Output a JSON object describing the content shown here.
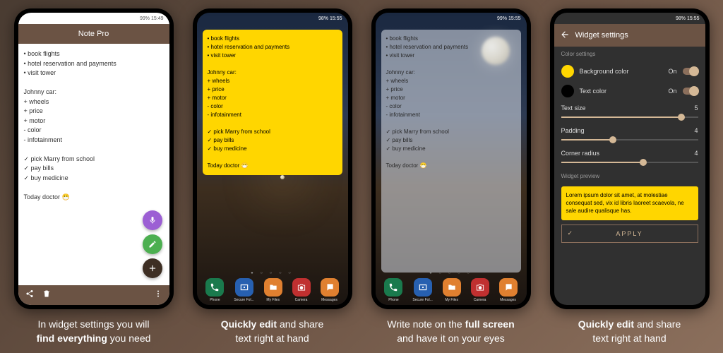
{
  "status": {
    "battery": "99%",
    "t1": "15:49",
    "t2": "15:55",
    "t3": "15:55",
    "t4": "15:55",
    "battery2": "98%"
  },
  "s1": {
    "title": "Note Pro"
  },
  "note": {
    "l1": "• book flights",
    "l2": "• hotel reservation and payments",
    "l3": "• visit tower",
    "l4": "Johnny car:",
    "l5": "+ wheels",
    "l6": "+ price",
    "l7": "+ motor",
    "l8": "- color",
    "l9": "- infotainment",
    "l10": "✓ pick Marry from school",
    "l11": "✓ pay bills",
    "l12": "✓ buy medicine",
    "l13": "Today doctor 😷"
  },
  "dock": {
    "a1": "Phone",
    "a2": "Secure Fol...",
    "a3": "My Files",
    "a4": "Camera",
    "a5": "Messages"
  },
  "s4": {
    "title": "Widget settings",
    "sec1": "Color settings",
    "bg": "Background color",
    "txt": "Text color",
    "on": "On",
    "ts": "Text size",
    "tsv": "5",
    "pad": "Padding",
    "padv": "4",
    "cr": "Corner radius",
    "crv": "4",
    "wp": "Widget preview",
    "lorem": "Lorem ipsum dolor sit amet, at molestiae consequat sed, vix id libris laoreet scaevola, ne sale audire qualisque has.",
    "apply": "APPLY"
  },
  "cap1a": "In widget settings you will",
  "cap1b": "find everything",
  "cap1c": " you need",
  "cap2a": "Quickly edit",
  "cap2b": " and share",
  "cap2c": "text right at hand",
  "cap3a": "Write note on the ",
  "cap3b": "full screen",
  "cap3c": "and have it on your eyes",
  "cap4a": "Quickly edit",
  "cap4b": " and share",
  "cap4c": "text right at hand"
}
